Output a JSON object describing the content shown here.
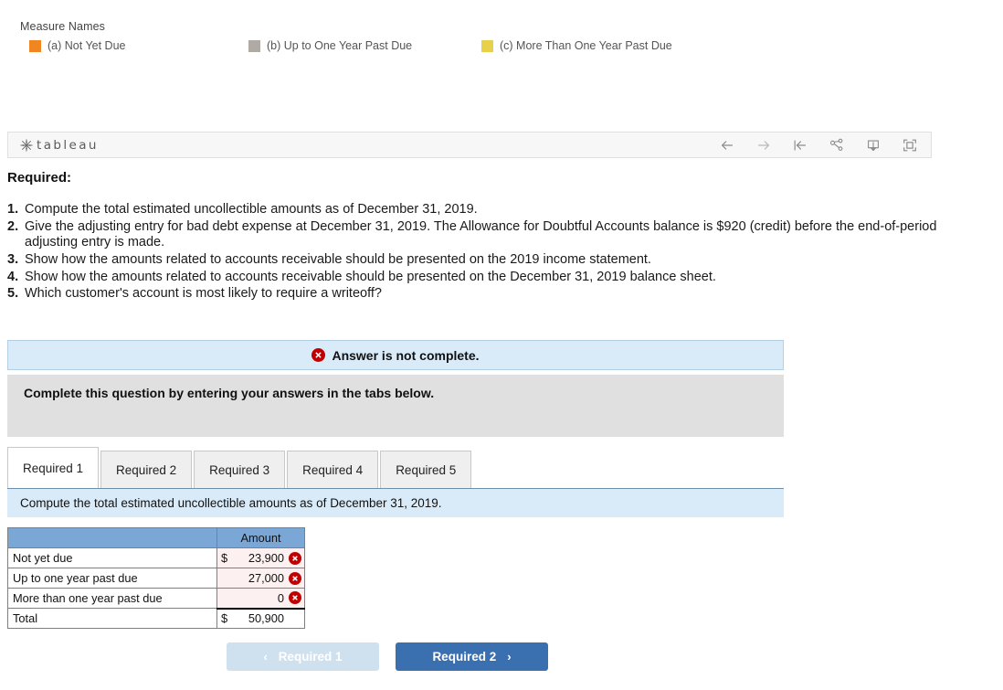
{
  "legend": {
    "title": "Measure Names",
    "items": [
      {
        "label": "(a) Not Yet Due",
        "color": "#f08521"
      },
      {
        "label": "(b) Up to One Year Past Due",
        "color": "#b0aaa4"
      },
      {
        "label": "(c) More Than One Year Past Due",
        "color": "#e8d14a"
      }
    ]
  },
  "tableau": {
    "wordmark": "tableau",
    "icons": [
      "back-arrow-icon",
      "forward-arrow-icon",
      "revert-icon",
      "share-icon",
      "download-icon",
      "fullscreen-icon"
    ]
  },
  "document": {
    "heading": "Required:",
    "items": [
      {
        "num": "1.",
        "text": "Compute the total estimated uncollectible amounts as of December 31, 2019."
      },
      {
        "num": "2.",
        "text": "Give the adjusting entry for bad debt expense at December 31, 2019.  The Allowance for Doubtful Accounts balance is $920 (credit) before the end-of-period adjusting entry is made."
      },
      {
        "num": "3.",
        "text": "Show how the amounts related to accounts receivable should be presented on the 2019 income statement."
      },
      {
        "num": "4.",
        "text": "Show how the amounts related to accounts receivable should be presented on the December 31, 2019 balance sheet."
      },
      {
        "num": "5.",
        "text": "Which customer's account is most likely to require a writeoff?"
      }
    ]
  },
  "alert": {
    "text": "Answer is not complete.",
    "icon": "error-x-icon",
    "color": "#c00000"
  },
  "instruction": {
    "text": "Complete this question by entering your answers in the tabs below."
  },
  "tabs": {
    "items": [
      {
        "label": "Required 1",
        "active": true
      },
      {
        "label": "Required 2",
        "active": false
      },
      {
        "label": "Required 3",
        "active": false
      },
      {
        "label": "Required 4",
        "active": false
      },
      {
        "label": "Required 5",
        "active": false
      }
    ]
  },
  "sub_instruction": {
    "text": "Compute the total estimated uncollectible amounts as of December 31, 2019."
  },
  "table": {
    "header": {
      "blank": "",
      "amount": "Amount"
    },
    "rows": [
      {
        "label": "Not yet due",
        "currency": "$",
        "value": "23,900",
        "error": true
      },
      {
        "label": "Up to one year past due",
        "currency": "",
        "value": "27,000",
        "error": true
      },
      {
        "label": "More than one year past due",
        "currency": "",
        "value": "0",
        "error": true
      }
    ],
    "total": {
      "label": "Total",
      "currency": "$",
      "value": "50,900"
    }
  },
  "footer": {
    "prev": {
      "label": "Required 1",
      "chevron": "‹",
      "disabled": true
    },
    "next": {
      "label": "Required 2",
      "chevron": "›",
      "disabled": false
    }
  }
}
